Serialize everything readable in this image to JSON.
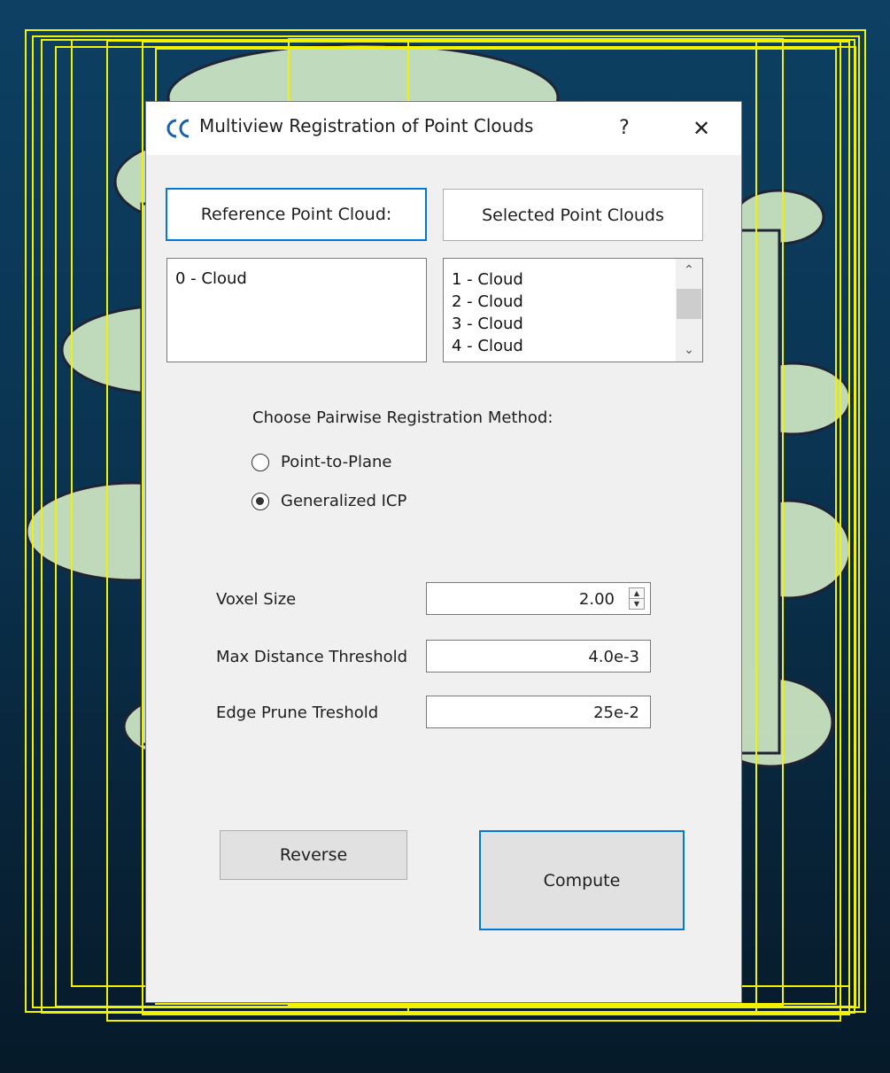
{
  "window": {
    "title": "Multiview Registration of Point Clouds",
    "help_symbol": "?",
    "close_symbol": "✕",
    "app_icon": "cc-logo-icon"
  },
  "headers": {
    "reference_label": "Reference Point Cloud:",
    "selected_label": "Selected Point Clouds"
  },
  "reference_list": [
    "0 - Cloud"
  ],
  "selected_list": [
    "1 - Cloud",
    "2 - Cloud",
    "3 - Cloud",
    "4 - Cloud"
  ],
  "method": {
    "heading": "Choose Pairwise Registration Method:",
    "options": [
      "Point-to-Plane",
      "Generalized ICP"
    ],
    "selected": "Generalized ICP"
  },
  "params": {
    "voxel_label": "Voxel Size",
    "voxel_value": "2.00",
    "max_dist_label": "Max Distance Threshold",
    "max_dist_value": "4.0e-3",
    "edge_prune_label": "Edge Prune Treshold",
    "edge_prune_value": "25e-2"
  },
  "buttons": {
    "reverse": "Reverse",
    "compute": "Compute"
  },
  "colors": {
    "bbox": "#f2f200",
    "accent": "#0078d7",
    "background_top": "#0d4063",
    "background_bottom": "#061a29"
  }
}
